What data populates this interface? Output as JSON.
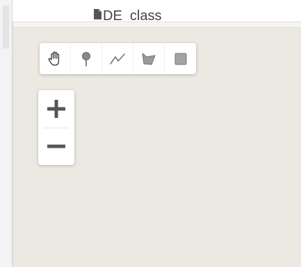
{
  "file_tree": {
    "item_label": "DE_class",
    "item_icon": "file-icon"
  },
  "draw_toolbar": {
    "tools": [
      {
        "icon": "hand-pan-icon"
      },
      {
        "icon": "marker-pin-icon"
      },
      {
        "icon": "polyline-icon"
      },
      {
        "icon": "polygon-icon"
      },
      {
        "icon": "rectangle-icon"
      }
    ]
  },
  "zoom_control": {
    "zoom_in_icon": "plus-icon",
    "zoom_out_icon": "minus-icon"
  },
  "colors": {
    "map_background": "#ece9e3",
    "icon_gray": "#555555",
    "panel_background": "#ffffff"
  }
}
